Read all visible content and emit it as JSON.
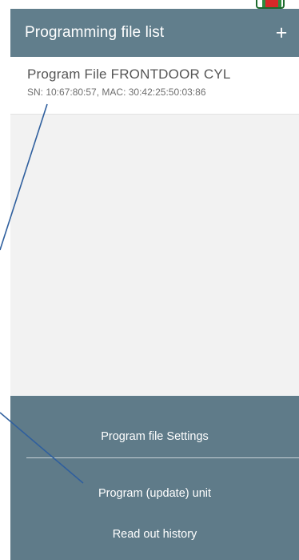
{
  "app_bar": {
    "title": "Programming file list",
    "add_icon": "+"
  },
  "files": [
    {
      "title": "Program File FRONTDOOR CYL",
      "subtitle": "SN: 10:67:80:57, MAC: 30:42:25:50:03:86"
    }
  ],
  "bottom_menu": {
    "settings_label": "Program file Settings",
    "program_label": "Program (update) unit",
    "history_label": "Read out history"
  },
  "colors": {
    "app_bar": "#617e8c",
    "bottom_menu": "#5f7b89",
    "annotation_line": "#2f5f9e"
  }
}
